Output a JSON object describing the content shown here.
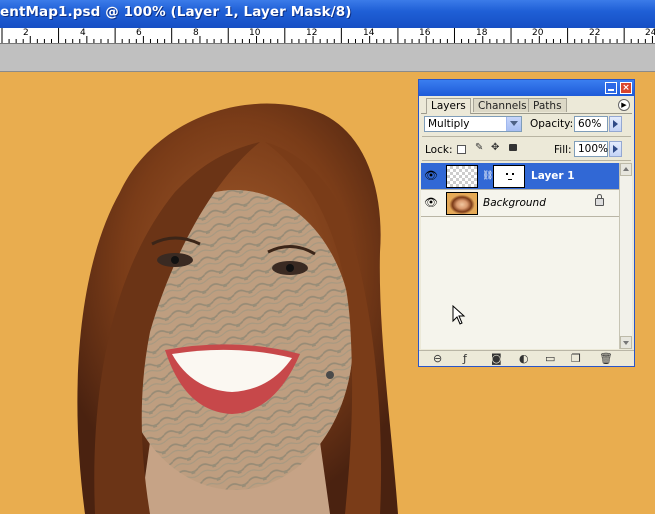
{
  "window": {
    "title": "entMap1.psd @ 100% (Layer 1, Layer Mask/8)"
  },
  "ruler": {
    "labels": [
      "2",
      "4",
      "6",
      "8",
      "10",
      "12",
      "14",
      "16",
      "18",
      "20",
      "22",
      "24"
    ]
  },
  "layers_palette": {
    "tabs": [
      "Layers",
      "Channels",
      "Paths"
    ],
    "active_tab": "Layers",
    "blend_mode": "Multiply",
    "opacity_label": "Opacity:",
    "opacity_value": "60%",
    "lock_label": "Lock:",
    "fill_label": "Fill:",
    "fill_value": "100%",
    "layers": [
      {
        "name": "Layer 1",
        "selected": true,
        "visible": true,
        "has_mask": true
      },
      {
        "name": "Background",
        "selected": false,
        "visible": true,
        "locked": true
      }
    ],
    "bottom_icons": [
      "link-icon",
      "layer-style-icon",
      "add-mask-icon",
      "adjustment-layer-icon",
      "new-group-icon",
      "new-layer-icon",
      "delete-icon"
    ]
  },
  "colors": {
    "canvas_background": "#e9ad4f",
    "title_bar": "#1f5fd6",
    "selected_layer": "#3168d5",
    "palette_background": "#ece9d8"
  }
}
